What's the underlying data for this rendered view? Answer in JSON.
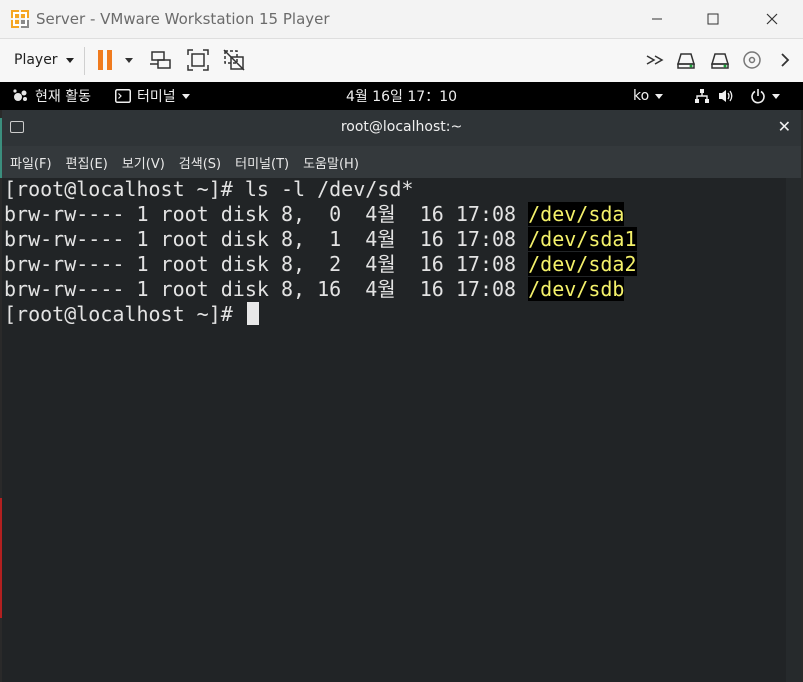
{
  "window": {
    "title": "Server - VMware Workstation 15 Player",
    "controls": [
      "minimize-icon",
      "maximize-icon",
      "close-icon"
    ]
  },
  "toolbar": {
    "player_label": "Player",
    "buttons": [
      "pause-icon",
      "send-ctrl-alt-del-icon",
      "fit-guest-icon",
      "unity-icon"
    ],
    "devices": [
      "network-icon",
      "hdd-icon",
      "hdd-icon",
      "cdrom-icon",
      "more-icon"
    ],
    "pause_color": "#f07b1e"
  },
  "topbar": {
    "activities": "현재 활동",
    "app_menu": "터미널",
    "clock": "4월 16일  17：10",
    "input_method": "ko"
  },
  "terminal": {
    "title": "root@localhost:~",
    "menu": [
      "파일(F)",
      "편집(E)",
      "보기(V)",
      "검색(S)",
      "터미널(T)",
      "도움말(H)"
    ],
    "lines": [
      {
        "text": "[root@localhost ~]# ls -l /dev/sd*"
      },
      {
        "text": "brw-rw---- 1 root disk 8,  0  4월  16 17:08 ",
        "highlight": "/dev/sda"
      },
      {
        "text": "brw-rw---- 1 root disk 8,  1  4월  16 17:08 ",
        "highlight": "/dev/sda1"
      },
      {
        "text": "brw-rw---- 1 root disk 8,  2  4월  16 17:08 ",
        "highlight": "/dev/sda2"
      },
      {
        "text": "brw-rw---- 1 root disk 8, 16  4월  16 17:08 ",
        "highlight": "/dev/sdb"
      },
      {
        "text": "[root@localhost ~]# "
      }
    ],
    "highlight_color": "#f4f16a"
  }
}
